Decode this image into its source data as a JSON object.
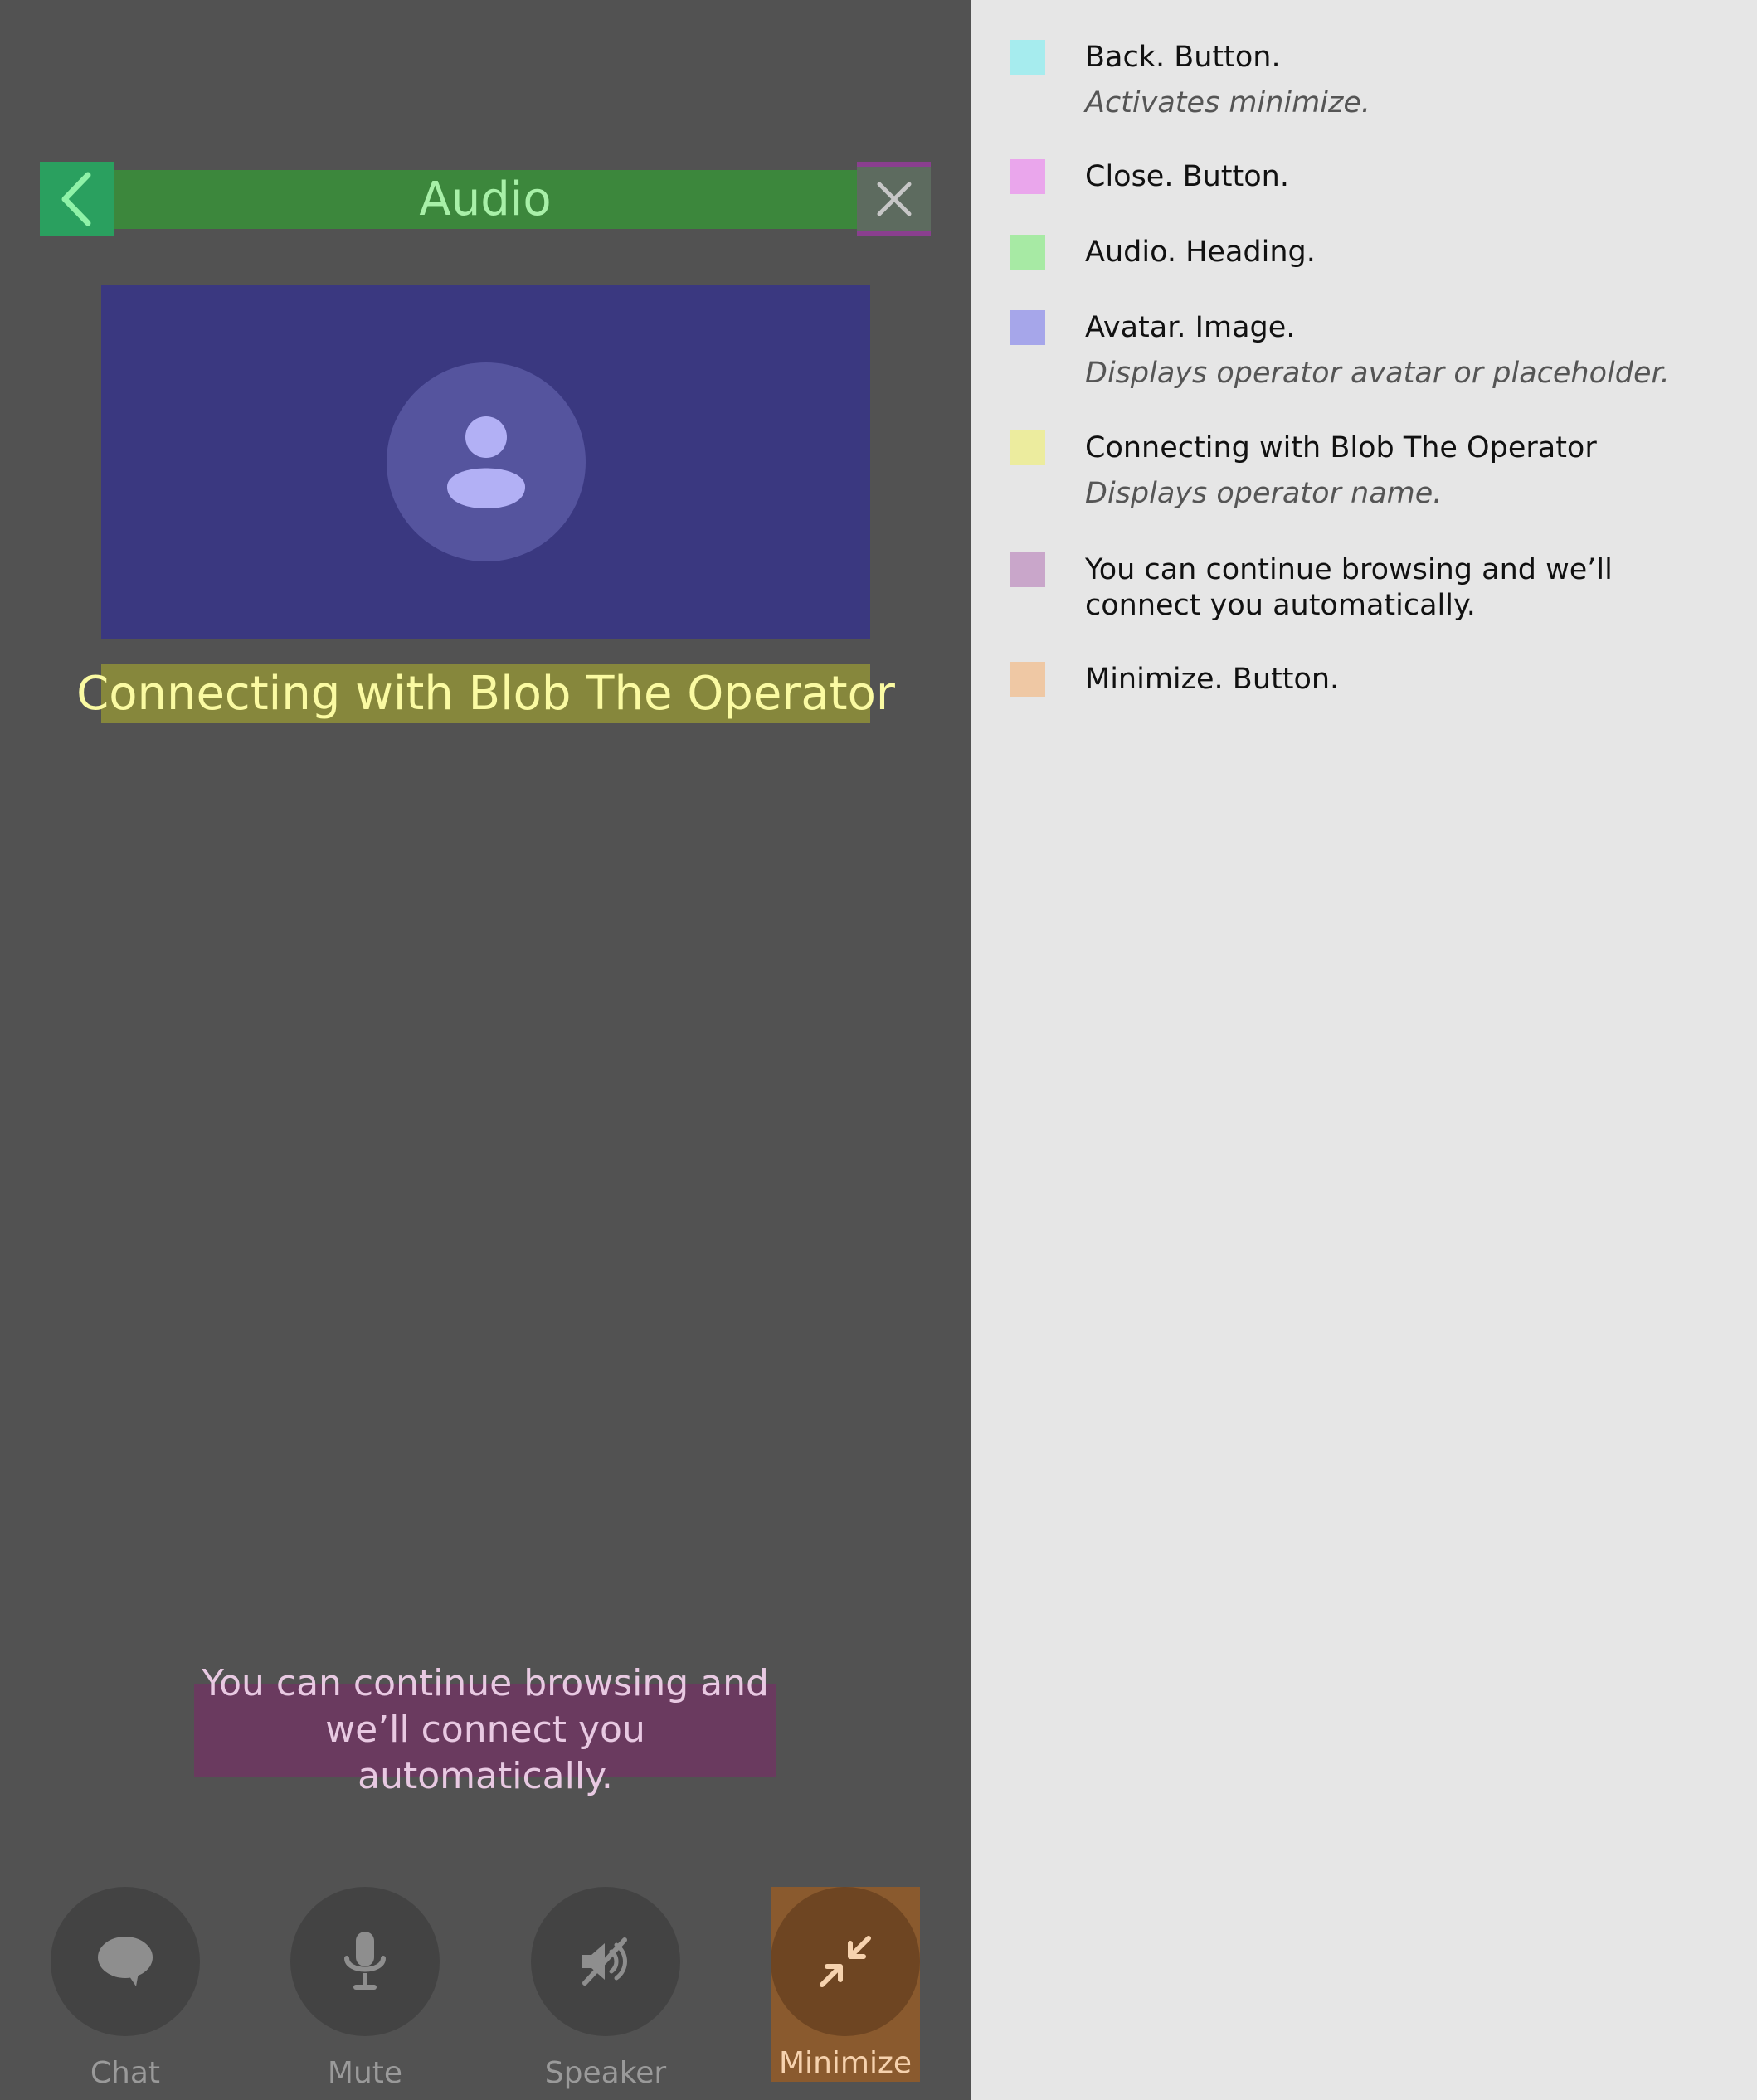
{
  "screen": {
    "heading": "Audio",
    "operator_name": "Connecting with Blob The Operator",
    "hint": "You can continue browsing and we’ll connect you automatically.",
    "controls": [
      {
        "label": "Chat",
        "icon": "chat-bubble-icon"
      },
      {
        "label": "Mute",
        "icon": "microphone-icon"
      },
      {
        "label": "Speaker",
        "icon": "speaker-off-icon"
      },
      {
        "label": "Minimize",
        "icon": "minimize-arrows-icon"
      }
    ]
  },
  "legend": {
    "items": [
      {
        "title": "Back. Button.",
        "description": "Activates minimize.",
        "color": "#a6ecee"
      },
      {
        "title": "Close. Button.",
        "description": "",
        "color": "#eaa6ec"
      },
      {
        "title": "Audio. Heading.",
        "description": "",
        "color": "#a7eaa4"
      },
      {
        "title": "Avatar. Image.",
        "description": "Displays operator avatar or placeholder.",
        "color": "#a6a6ea"
      },
      {
        "title": "Connecting with Blob The Operator",
        "description": "Displays operator name.",
        "color": "#ecec9e"
      },
      {
        "title": "You can continue browsing and we’ll connect you automatically.",
        "description": "",
        "color": "#c9a6ca"
      },
      {
        "title": "Minimize. Button.",
        "description": "",
        "color": "#efc8a4"
      }
    ]
  }
}
